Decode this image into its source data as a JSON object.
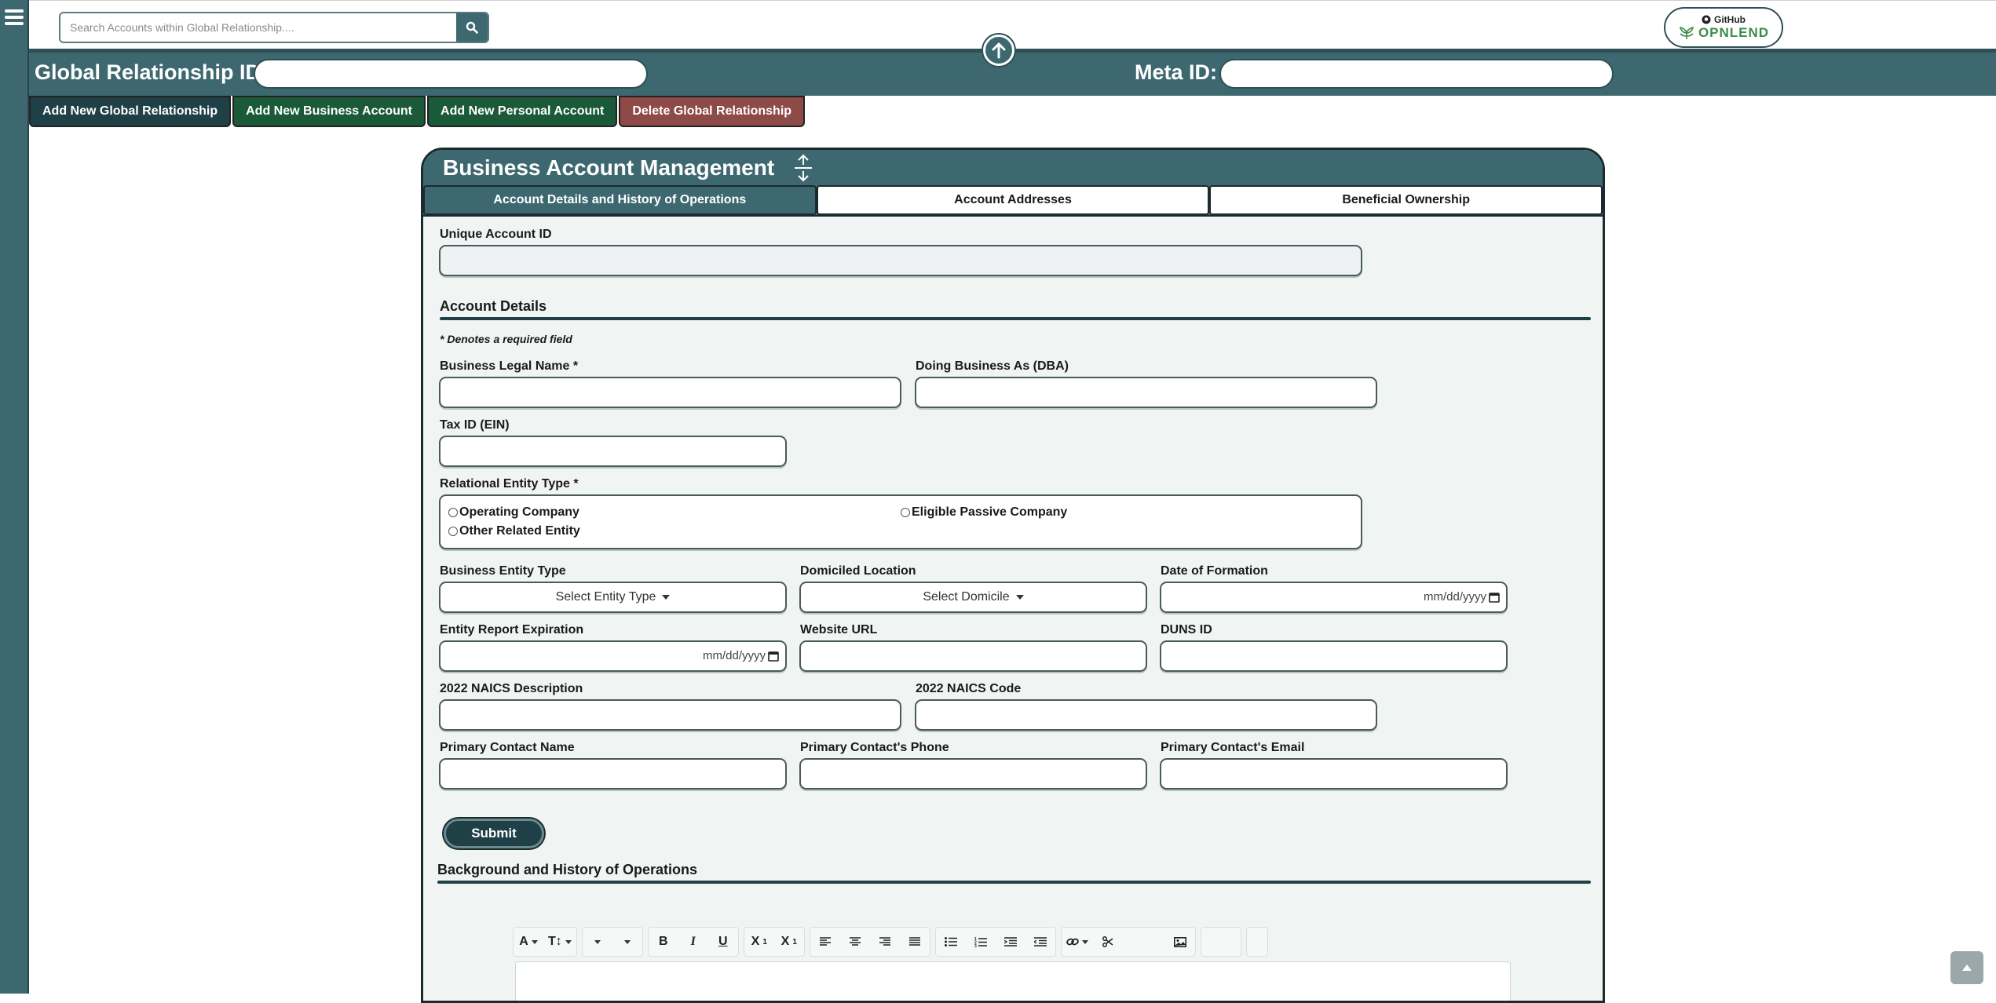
{
  "search": {
    "placeholder": "Search Accounts within Global Relationship...."
  },
  "logo": {
    "top": "GitHub",
    "bottom": "OPNLEND"
  },
  "idbar": {
    "global_label": "Global Relationship ID:",
    "meta_label": "Meta ID:"
  },
  "actions": [
    {
      "label": "Add New Global Relationship"
    },
    {
      "label": "Add New Business Account"
    },
    {
      "label": "Add New Personal Account"
    },
    {
      "label": "Delete Global Relationship"
    }
  ],
  "panel": {
    "title": "Business Account Management",
    "tabs": [
      {
        "label": "Account Details and History of Operations",
        "active": true
      },
      {
        "label": "Account Addresses",
        "active": false
      },
      {
        "label": "Beneficial Ownership",
        "active": false
      }
    ]
  },
  "form": {
    "unique_id_label": "Unique Account ID",
    "section_account_details": "Account Details",
    "required_note": "* Denotes a required field",
    "legal_name_label": "Business Legal Name *",
    "dba_label": "Doing Business As (DBA)",
    "tax_id_label": "Tax ID (EIN)",
    "entity_type_label": "Relational Entity Type *",
    "radio_operating": "Operating Company",
    "radio_passive": "Eligible Passive Company",
    "radio_other": "Other Related Entity",
    "business_entity_type_label": "Business Entity Type",
    "business_entity_type_value": "Select Entity Type",
    "domiciled_label": "Domiciled Location",
    "domiciled_value": "Select Domicile",
    "formation_date_label": "Date of Formation",
    "date_placeholder": "mm/dd/yyyy",
    "report_expiration_label": "Entity Report Expiration",
    "website_label": "Website URL",
    "duns_label": "DUNS ID",
    "naics_desc_label": "2022 NAICS Description",
    "naics_code_label": "2022 NAICS Code",
    "contact_name_label": "Primary Contact Name",
    "contact_phone_label": "Primary Contact's Phone",
    "contact_email_label": "Primary Contact's Email",
    "submit_label": "Submit",
    "section_background": "Background and History of Operations"
  },
  "editor": {
    "toolbar_icons": [
      "font-style-icon",
      "font-size-icon",
      "heading-icon",
      "line-height-icon",
      "bold-icon",
      "italic-icon",
      "underline-icon",
      "subscript-icon",
      "superscript-icon",
      "align-left-icon",
      "align-center-icon",
      "align-right-icon",
      "align-justify-icon",
      "bullet-list-icon",
      "numbered-list-icon",
      "indent-icon",
      "outdent-icon",
      "link-icon",
      "unlink-icon",
      "image-icon"
    ],
    "bold": "B",
    "italic": "I",
    "underline": "U",
    "subscript": "X",
    "superscript": "X"
  },
  "colors": {
    "brand": "#3d6870",
    "dark": "#1f4046",
    "green": "#1a5a38",
    "danger": "#8e4a46",
    "panel_bg": "#f0f5f4"
  }
}
